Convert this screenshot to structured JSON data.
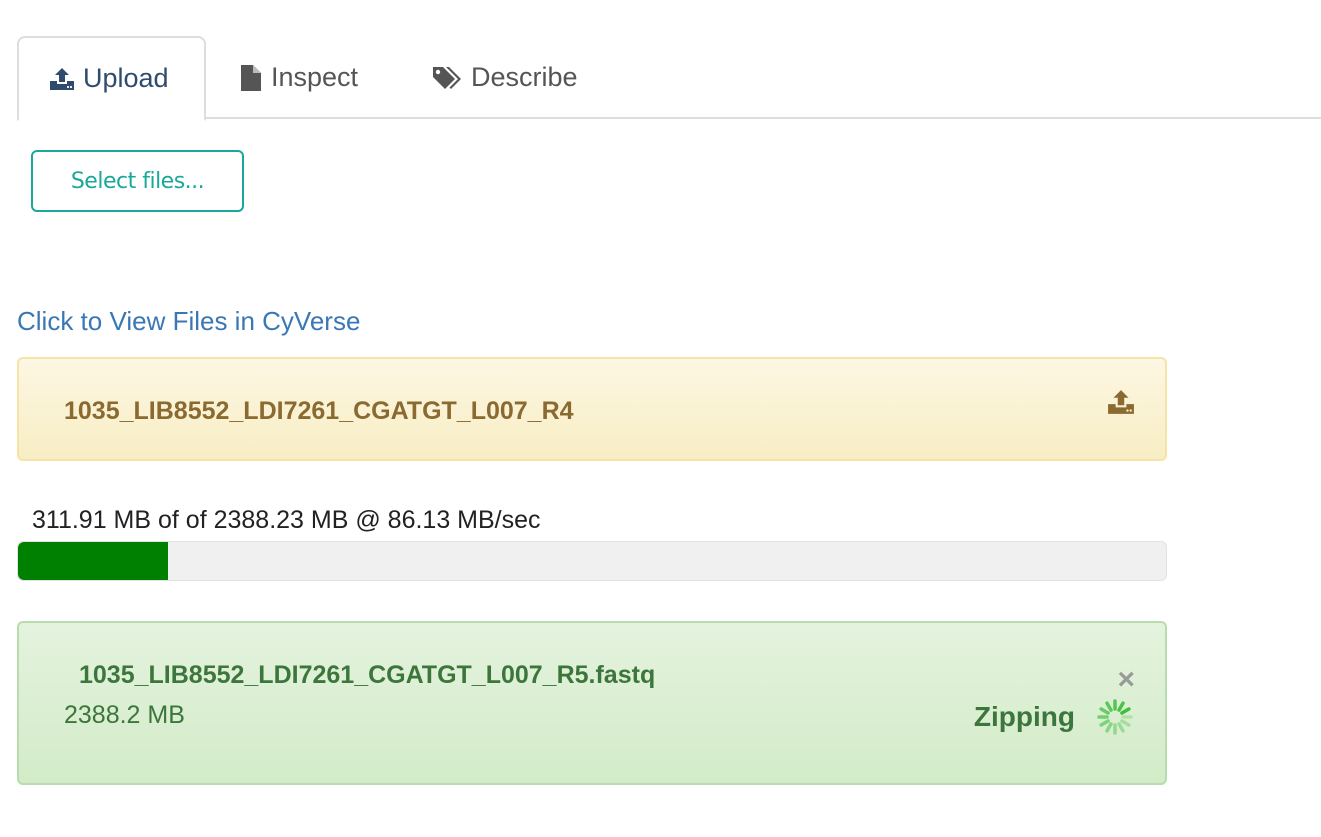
{
  "tabs": [
    {
      "label": "Upload",
      "icon": "upload-icon",
      "active": true
    },
    {
      "label": "Inspect",
      "icon": "file-icon",
      "active": false
    },
    {
      "label": "Describe",
      "icon": "tags-icon",
      "active": false
    }
  ],
  "select_button": {
    "label": "Select files..."
  },
  "view_link": {
    "label": "Click to View Files in CyVerse"
  },
  "upload_item": {
    "filename": "1035_LIB8552_LDI7261_CGATGT_L007_R4",
    "action_icon": "upload-icon"
  },
  "progress": {
    "text": "311.91 MB of of 2388.23 MB @ 86.13 MB/sec",
    "fraction": 0.1306,
    "color": "#008000"
  },
  "completed_item": {
    "filename": "1035_LIB8552_LDI7261_CGATGT_L007_R5.fastq",
    "size": "2388.2 MB",
    "status": "Zipping",
    "close_symbol": "×",
    "status_icon": "spinner-icon"
  },
  "colors": {
    "accent": "#1aa89a",
    "link": "#3a77b5",
    "warning_text": "#8a6a30",
    "success_text": "#3c763d"
  }
}
